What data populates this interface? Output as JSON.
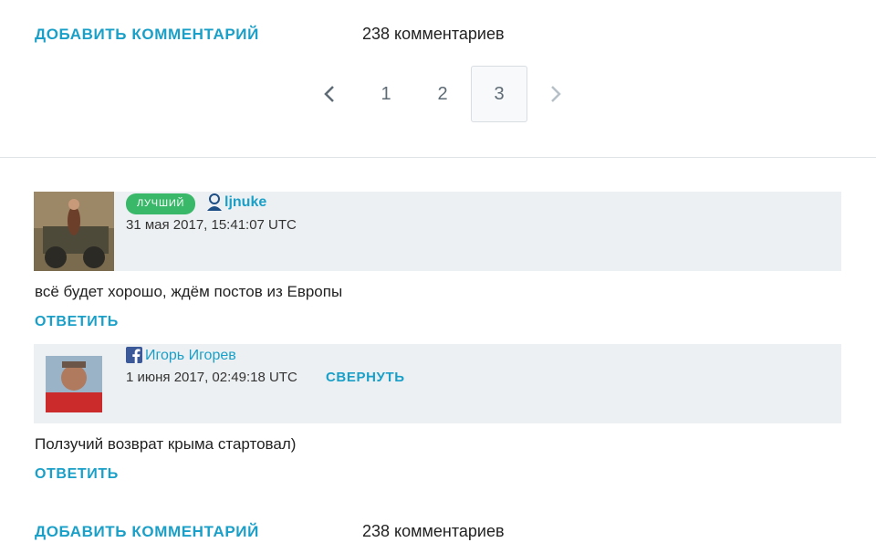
{
  "top_bar": {
    "add_comment": "ДОБАВИТЬ КОММЕНТАРИЙ",
    "count": "238 комментариев"
  },
  "pagination": {
    "pages": [
      "1",
      "2",
      "3"
    ],
    "current": "3"
  },
  "comments": [
    {
      "badge": "лучший",
      "user": "ljnuke",
      "user_icon": "livejournal-user-icon",
      "date": "31 мая 2017, 15:41:07 UTC",
      "text": "всё будет хорошо, ждём постов из Европы",
      "reply": "ОТВЕТИТЬ"
    },
    {
      "user": "Игорь Игорев",
      "user_icon": "facebook-icon",
      "date": "1 июня 2017, 02:49:18 UTC",
      "collapse": "СВЕРНУТЬ",
      "text": "Ползучий возврат крыма стартовал)",
      "reply": "ОТВЕТИТЬ"
    }
  ],
  "bottom_bar": {
    "add_comment": "ДОБАВИТЬ КОММЕНТАРИЙ",
    "count": "238 комментариев"
  },
  "colors": {
    "accent": "#1aa0c8",
    "badge": "#3ab86a",
    "header_bg": "#edf0f2",
    "facebook": "#3b5998"
  }
}
